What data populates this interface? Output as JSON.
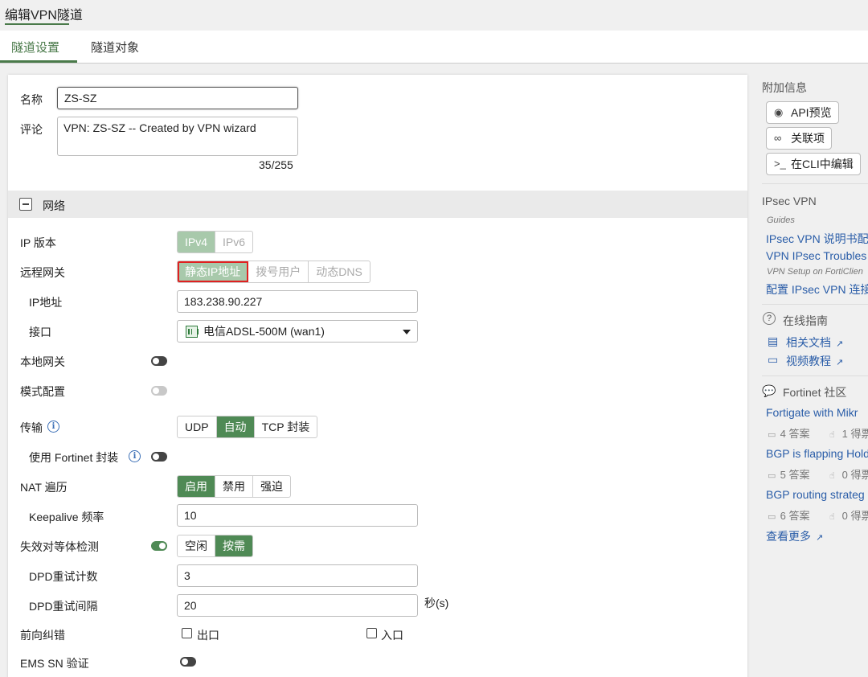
{
  "page_title": "编辑VPN隧道",
  "tabs": [
    "隧道设置",
    "隧道对象"
  ],
  "form": {
    "name_label": "名称",
    "name_value": "ZS-SZ",
    "comment_label": "评论",
    "comment_value": "VPN: ZS-SZ -- Created by VPN wizard",
    "comment_counter": "35/255"
  },
  "network": {
    "section_label": "网络",
    "ip_version_label": "IP 版本",
    "ip_version_options": [
      "IPv4",
      "IPv6"
    ],
    "ip_version_selected": "IPv4",
    "remote_gw_label": "远程网关",
    "remote_gw_options": [
      "静态IP地址",
      "拨号用户",
      "动态DNS"
    ],
    "remote_gw_selected": "静态IP地址",
    "ip_address_label": "IP地址",
    "ip_address_value": "183.238.90.227",
    "interface_label": "接口",
    "interface_value": "电信ADSL-500M (wan1)",
    "local_gw_label": "本地网关",
    "mode_config_label": "模式配置",
    "transport_label": "传输",
    "transport_options": [
      "UDP",
      "自动",
      "TCP 封装"
    ],
    "transport_selected": "自动",
    "fortinet_encap_label": "使用 Fortinet 封装",
    "nat_label": "NAT 遍历",
    "nat_options": [
      "启用",
      "禁用",
      "强迫"
    ],
    "nat_selected": "启用",
    "keepalive_label": "Keepalive 频率",
    "keepalive_value": "10",
    "dpd_label": "失效对等体检测",
    "dpd_options": [
      "空闲",
      "按需"
    ],
    "dpd_selected": "按需",
    "dpd_retry_count_label": "DPD重试计数",
    "dpd_retry_count_value": "3",
    "dpd_retry_interval_label": "DPD重试间隔",
    "dpd_retry_interval_value": "20",
    "dpd_retry_interval_unit": "秒(s)",
    "fec_label": "前向纠错",
    "fec_egress": "出口",
    "fec_ingress": "入口",
    "ems_sn_label": "EMS SN 验证"
  },
  "sidebar": {
    "additional_info": "附加信息",
    "api_preview": "API预览",
    "references": "关联项",
    "edit_cli": "在CLI中编辑",
    "ipsec_heading": "IPsec VPN",
    "guides_label": "Guides",
    "guide_1": "IPsec VPN 说明书配",
    "guide_2": "VPN IPsec Troubles",
    "guide_sub": "VPN Setup on FortiClien",
    "guide_3": "配置 IPsec VPN 连接",
    "online_guide": "在线指南",
    "related_docs": "相关文档",
    "video_tutorials": "视频教程",
    "community": "Fortinet 社区",
    "posts": [
      {
        "title": "Fortigate with Mikr",
        "answers": "4 答案",
        "likes": "1 得票"
      },
      {
        "title": "BGP is flapping Hold",
        "answers": "5 答案",
        "likes": "0 得票"
      },
      {
        "title": "BGP routing strateg",
        "answers": "6 答案",
        "likes": "0 得票"
      }
    ],
    "view_more": "查看更多"
  },
  "colors": {
    "accent_green": "#4f8a55",
    "link_blue": "#2a5da8",
    "highlight_red": "#e02020"
  }
}
